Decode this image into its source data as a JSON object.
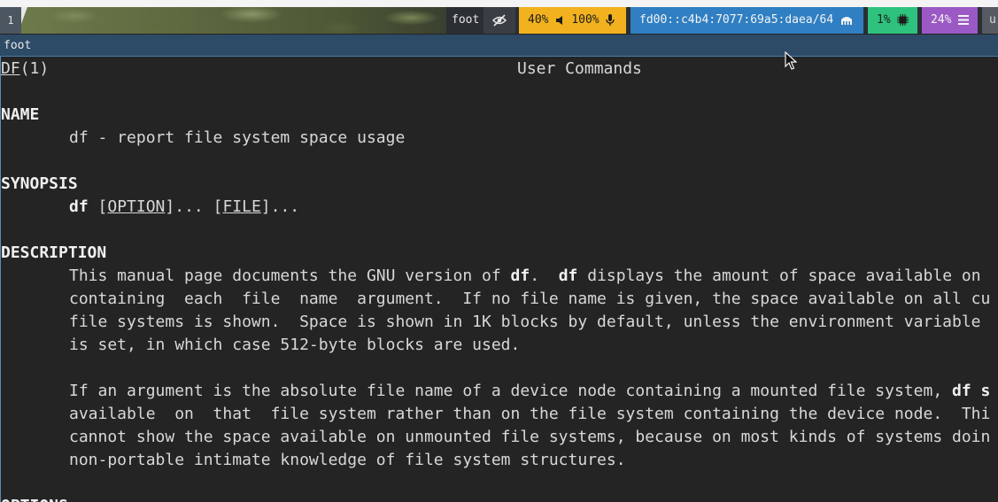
{
  "waybar": {
    "workspace": "1",
    "window_title": "foot",
    "audio": {
      "volume": "40%",
      "mic": "100%"
    },
    "network": "fd00::c4b4:7077:69a5:daea/64",
    "cpu": "1%",
    "memory": "24%",
    "last_module": "u",
    "icons": [
      "eye-slash-icon",
      "speaker-icon",
      "microphone-icon",
      "ethernet-icon",
      "cpu-chip-icon",
      "memory-icon"
    ],
    "colors": {
      "audio": "#f2b21f",
      "network": "#2f7fc2",
      "cpu": "#2ec27e",
      "memory": "#9a59c4"
    }
  },
  "window": {
    "title": "foot"
  },
  "man": {
    "header_left": "DF",
    "header_left_section": "(1)",
    "header_center": "User Commands",
    "name_heading": "NAME",
    "name_line": "df - report file system space usage",
    "synopsis_heading": "SYNOPSIS",
    "synopsis": {
      "cmd": "df",
      "opt1": "[",
      "opt1_u": "OPTION",
      "opt1_end": "]... ",
      "opt2": "[",
      "opt2_u": "FILE",
      "opt2_end": "]..."
    },
    "description_heading": "DESCRIPTION",
    "desc1": {
      "a": "This manual page documents the GNU version of ",
      "b": "df",
      "c": ".  ",
      "d": "df",
      "e": " displays the amount of space available on"
    },
    "desc2": "containing  each  file  name  argument.  If no file name is given, the space available on all cu",
    "desc3": "file systems is shown.  Space is shown in 1K blocks by default, unless the environment variable",
    "desc4": "is set, in which case 512-byte blocks are used.",
    "desc5": {
      "a": "If an argument is the absolute file name of a device node containing a mounted file system, ",
      "b": "df s"
    },
    "desc6": "available  on  that  file system rather than on the file system containing the device node.  Thi",
    "desc7": "cannot show the space available on unmounted file systems, because on most kinds of systems doin",
    "desc8": "non-portable intimate knowledge of file system structures.",
    "options_heading": "OPTIONS"
  }
}
